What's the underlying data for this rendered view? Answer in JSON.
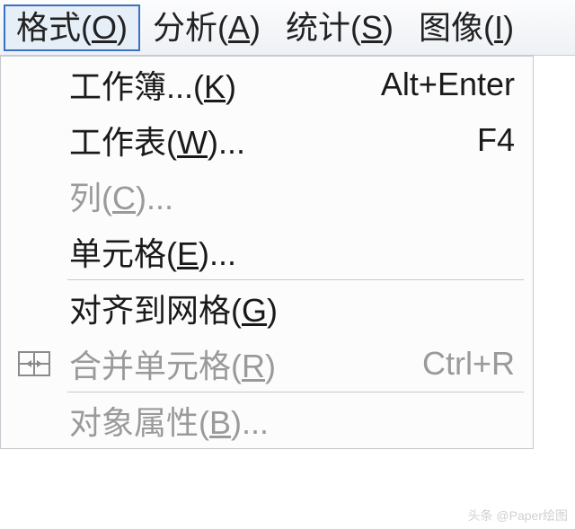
{
  "menubar": {
    "items": [
      {
        "pre": "格式(",
        "mn": "O",
        "post": ")",
        "selected": true
      },
      {
        "pre": "分析(",
        "mn": "A",
        "post": ")",
        "selected": false
      },
      {
        "pre": "统计(",
        "mn": "S",
        "post": ")",
        "selected": false
      },
      {
        "pre": "图像(",
        "mn": "I",
        "post": ")",
        "selected": false
      }
    ]
  },
  "dropdown": {
    "items": [
      {
        "type": "item",
        "pre": "工作簿...(",
        "mn": "K",
        "post": ")",
        "shortcut": "Alt+Enter",
        "enabled": true,
        "icon": null
      },
      {
        "type": "item",
        "pre": "工作表(",
        "mn": "W",
        "post": ")...",
        "shortcut": "F4",
        "enabled": true,
        "icon": null
      },
      {
        "type": "item",
        "pre": "列(",
        "mn": "C",
        "post": ")...",
        "shortcut": "",
        "enabled": false,
        "icon": null
      },
      {
        "type": "item",
        "pre": "单元格(",
        "mn": "E",
        "post": ")...",
        "shortcut": "",
        "enabled": true,
        "icon": null
      },
      {
        "type": "sep"
      },
      {
        "type": "item",
        "pre": "对齐到网格(",
        "mn": "G",
        "post": ")",
        "shortcut": "",
        "enabled": true,
        "icon": null
      },
      {
        "type": "item",
        "pre": "合并单元格(",
        "mn": "R",
        "post": ")",
        "shortcut": "Ctrl+R",
        "enabled": false,
        "icon": "merge-cells-icon"
      },
      {
        "type": "sep"
      },
      {
        "type": "item",
        "pre": "对象属性(",
        "mn": "B",
        "post": ")...",
        "shortcut": "",
        "enabled": false,
        "icon": null
      }
    ]
  },
  "watermark": "头条 @Paper绘图"
}
